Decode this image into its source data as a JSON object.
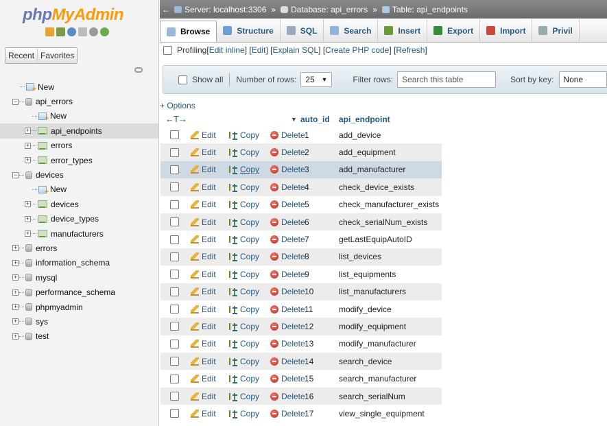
{
  "nav": {
    "logo": {
      "php": "php",
      "my": "My",
      "admin": "Admin"
    },
    "recent_label": "Recent",
    "favorites_label": "Favorites",
    "tree": [
      {
        "label": "New",
        "level": 0,
        "type": "new",
        "expander": "none"
      },
      {
        "label": "api_errors",
        "level": 0,
        "type": "db",
        "expander": "minus"
      },
      {
        "label": "New",
        "level": 1,
        "type": "new",
        "expander": "none"
      },
      {
        "label": "api_endpoints",
        "level": 1,
        "type": "table",
        "expander": "plus",
        "selected": true
      },
      {
        "label": "errors",
        "level": 1,
        "type": "table",
        "expander": "plus"
      },
      {
        "label": "error_types",
        "level": 1,
        "type": "table",
        "expander": "plus"
      },
      {
        "label": "devices",
        "level": 0,
        "type": "db",
        "expander": "minus"
      },
      {
        "label": "New",
        "level": 1,
        "type": "new",
        "expander": "none"
      },
      {
        "label": "devices",
        "level": 1,
        "type": "table",
        "expander": "plus"
      },
      {
        "label": "device_types",
        "level": 1,
        "type": "table",
        "expander": "plus"
      },
      {
        "label": "manufacturers",
        "level": 1,
        "type": "table",
        "expander": "plus"
      },
      {
        "label": "errors",
        "level": 0,
        "type": "db",
        "expander": "plus"
      },
      {
        "label": "information_schema",
        "level": 0,
        "type": "db",
        "expander": "plus"
      },
      {
        "label": "mysql",
        "level": 0,
        "type": "db",
        "expander": "plus"
      },
      {
        "label": "performance_schema",
        "level": 0,
        "type": "db",
        "expander": "plus"
      },
      {
        "label": "phpmyadmin",
        "level": 0,
        "type": "db",
        "expander": "plus"
      },
      {
        "label": "sys",
        "level": 0,
        "type": "db",
        "expander": "plus"
      },
      {
        "label": "test",
        "level": 0,
        "type": "db",
        "expander": "plus"
      }
    ]
  },
  "breadcrumb": {
    "server": "Server: localhost:3306",
    "database": "Database: api_errors",
    "table": "Table: api_endpoints",
    "separator": "»"
  },
  "tabs": [
    {
      "label": "Browse",
      "icon": "browse-icon",
      "active": true
    },
    {
      "label": "Structure",
      "icon": "structure-icon"
    },
    {
      "label": "SQL",
      "icon": "sql-icon"
    },
    {
      "label": "Search",
      "icon": "search-icon"
    },
    {
      "label": "Insert",
      "icon": "insert-icon"
    },
    {
      "label": "Export",
      "icon": "export-icon"
    },
    {
      "label": "Import",
      "icon": "import-icon"
    },
    {
      "label": "Privil",
      "icon": "privileges-icon"
    }
  ],
  "profiling": {
    "label": "Profiling",
    "links": [
      "Edit inline",
      "Edit",
      "Explain SQL",
      "Create PHP code",
      "Refresh"
    ]
  },
  "navbar": {
    "show_all": "Show all",
    "rows_label": "Number of rows:",
    "rows_value": "25",
    "filter_label": "Filter rows:",
    "filter_placeholder": "Search this table",
    "sort_label": "Sort by key:",
    "sort_value": "None"
  },
  "table": {
    "options_label": "+ Options",
    "columns": [
      "auto_id",
      "api_endpoint"
    ],
    "actions": {
      "edit": "Edit",
      "copy": "Copy",
      "delete": "Delete"
    },
    "rows": [
      {
        "id": "1",
        "endpoint": "add_device"
      },
      {
        "id": "2",
        "endpoint": "add_equipment"
      },
      {
        "id": "3",
        "endpoint": "add_manufacturer"
      },
      {
        "id": "4",
        "endpoint": "check_device_exists"
      },
      {
        "id": "5",
        "endpoint": "check_manufacturer_exists"
      },
      {
        "id": "6",
        "endpoint": "check_serialNum_exists"
      },
      {
        "id": "7",
        "endpoint": "getLastEquipAutoID"
      },
      {
        "id": "8",
        "endpoint": "list_devices"
      },
      {
        "id": "9",
        "endpoint": "list_equipments"
      },
      {
        "id": "10",
        "endpoint": "list_manufacturers"
      },
      {
        "id": "11",
        "endpoint": "modify_device"
      },
      {
        "id": "12",
        "endpoint": "modify_equipment"
      },
      {
        "id": "13",
        "endpoint": "modify_manufacturer"
      },
      {
        "id": "14",
        "endpoint": "search_device"
      },
      {
        "id": "15",
        "endpoint": "search_manufacturer"
      },
      {
        "id": "16",
        "endpoint": "search_serialNum"
      },
      {
        "id": "17",
        "endpoint": "view_single_equipment"
      }
    ]
  },
  "colors": {
    "link": "#235a81",
    "highlight_row": "#ced9e3",
    "logo_blue": "#6c78af",
    "logo_orange": "#f89c0e"
  }
}
